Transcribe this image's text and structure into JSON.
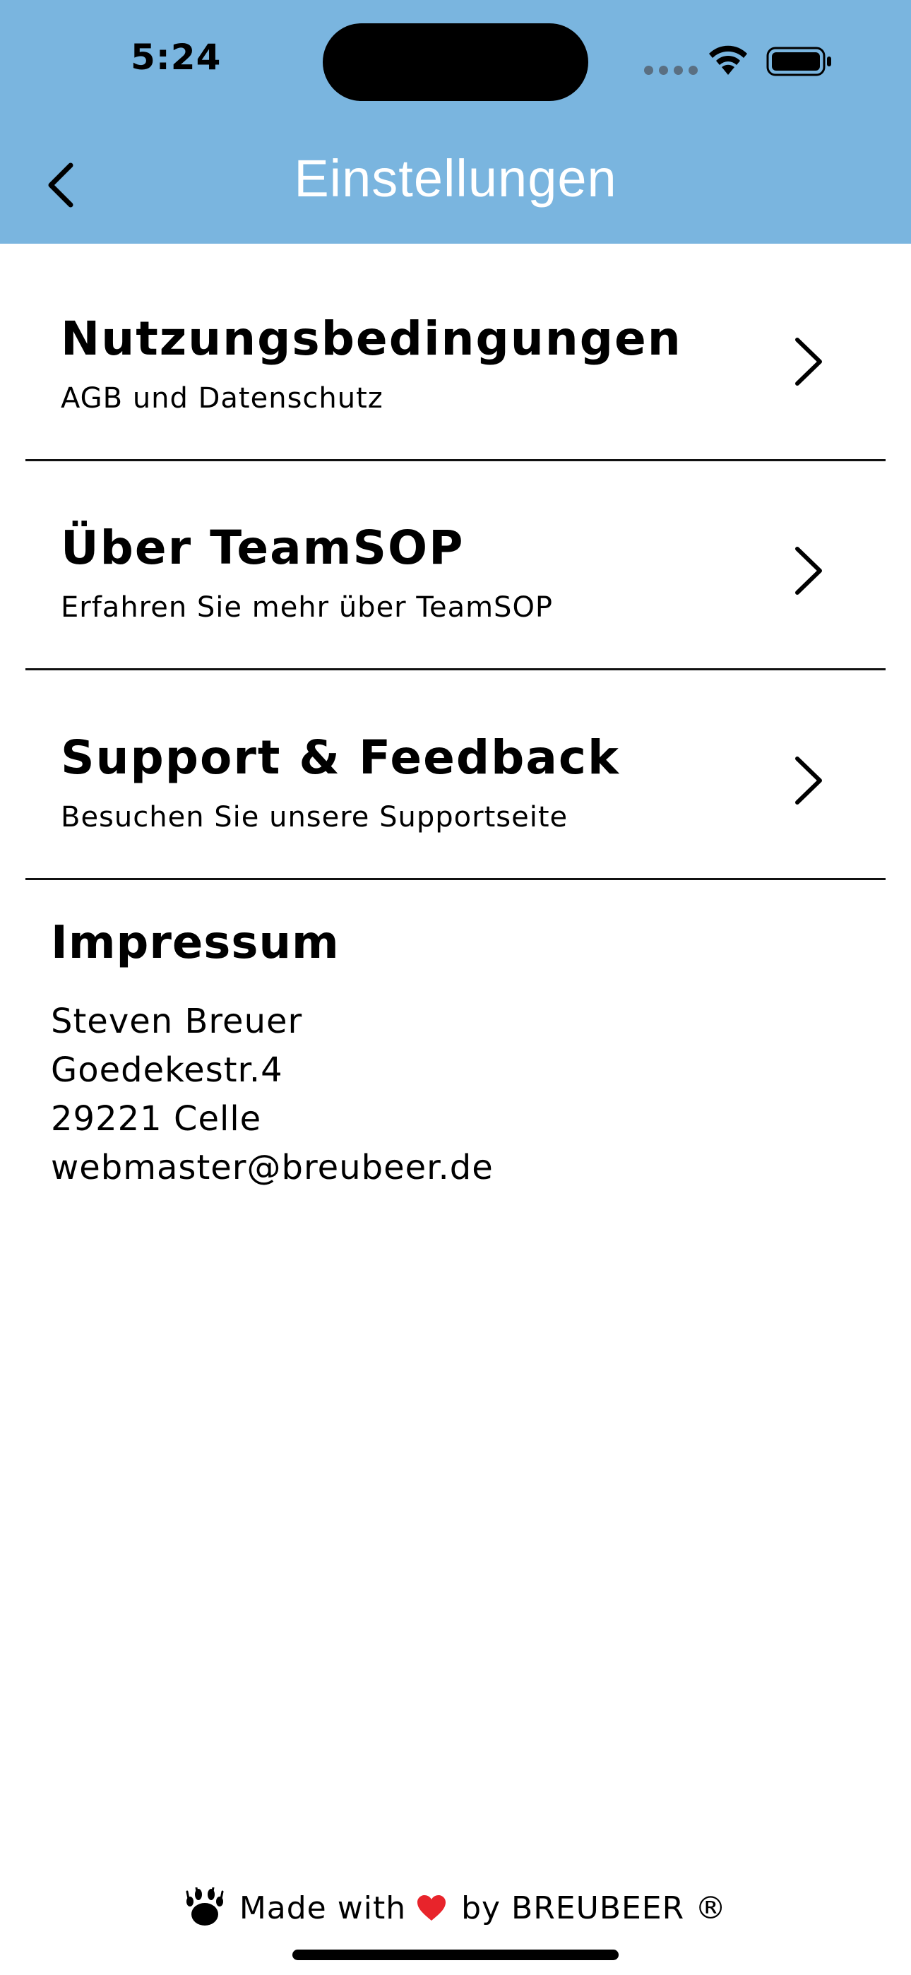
{
  "status_bar": {
    "time": "5:24"
  },
  "nav": {
    "title": "Einstellungen",
    "back_icon": "chevron-left-icon"
  },
  "menu": [
    {
      "title": "Nutzungsbedingungen",
      "subtitle": "AGB und Datenschutz"
    },
    {
      "title": "Über TeamSOP",
      "subtitle": "Erfahren Sie mehr über TeamSOP"
    },
    {
      "title": "Support & Feedback",
      "subtitle": "Besuchen Sie unsere Supportseite"
    }
  ],
  "imprint": {
    "heading": "Impressum",
    "lines": [
      "Steven Breuer",
      "Goedekestr.4",
      "29221 Celle",
      "webmaster@breubeer.de"
    ]
  },
  "footer": {
    "made_with": "Made with",
    "by": "by BREUBEER ®"
  },
  "colors": {
    "header_bg": "#7ab5df",
    "heart": "#e8242b"
  }
}
